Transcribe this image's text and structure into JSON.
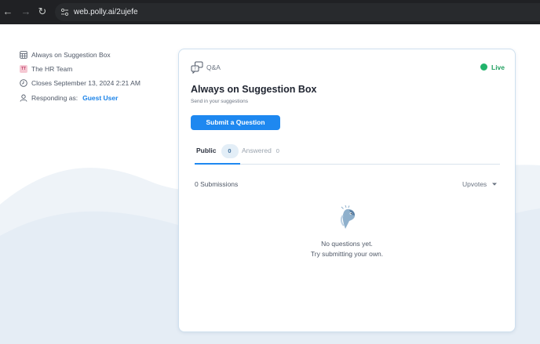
{
  "browser": {
    "url": "web.polly.ai/2ujefe",
    "icons": [
      "back-arrow-icon",
      "forward-arrow-icon",
      "reload-icon",
      "site-info-icon"
    ]
  },
  "sidebar": {
    "title": "Always on Suggestion Box",
    "team_avatar": "TT",
    "team": "The HR Team",
    "closes": "Closes September 13, 2024 2:21 AM",
    "responding_label": "Responding as:",
    "responding_user": "Guest User"
  },
  "card": {
    "type_label": "Q&A",
    "status": "Live",
    "title": "Always on Suggestion Box",
    "subtitle": "Send in your suggestions",
    "submit_label": "Submit a Question",
    "tabs": [
      {
        "label": "Public",
        "count": "0",
        "active": true
      },
      {
        "label": "Answered",
        "count": "0",
        "active": false
      }
    ],
    "submissions": "0 Submissions",
    "sort_label": "Upvotes",
    "empty_line1": "No questions yet.",
    "empty_line2": "Try submitting your own."
  },
  "colors": {
    "accent": "#1e88f0",
    "live": "#21b36b",
    "browser_bg": "#202124"
  }
}
